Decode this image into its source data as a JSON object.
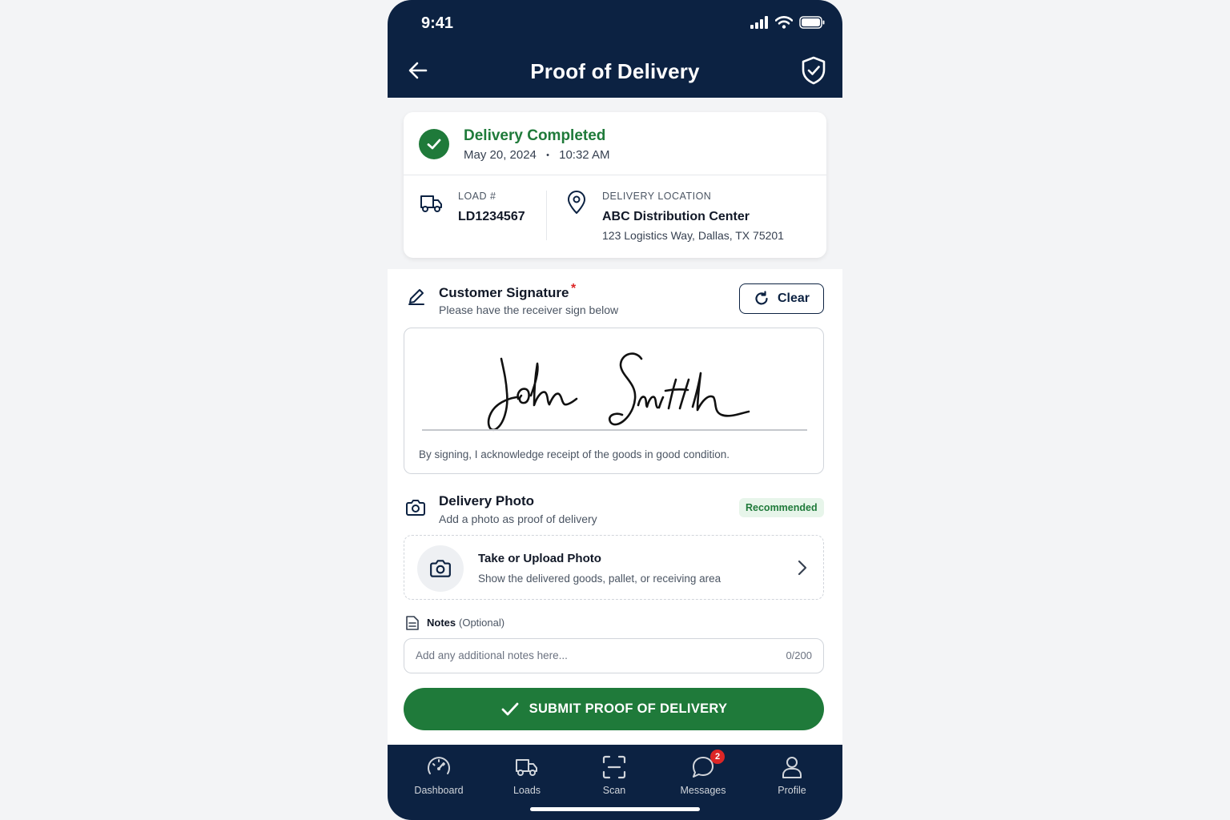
{
  "status_bar": {
    "time": "9:41"
  },
  "header": {
    "title": "Proof of Delivery"
  },
  "summary": {
    "status_title": "Delivery Completed",
    "date": "May 20, 2024",
    "separator": "•",
    "time": "10:32 AM",
    "load_label": "LOAD #",
    "load_value": "LD1234567",
    "location_label": "DELIVERY LOCATION",
    "location_name": "ABC Distribution Center",
    "location_address": "123 Logistics Way, Dallas, TX 75201"
  },
  "signature": {
    "title": "Customer Signature",
    "required_mark": "*",
    "subtitle": "Please have the receiver sign below",
    "clear_label": "Clear",
    "acknowledgement": "By signing, I acknowledge receipt of the goods in good condition."
  },
  "photo": {
    "title": "Delivery Photo",
    "subtitle": "Add a photo as proof of delivery",
    "badge": "Recommended",
    "upload_title": "Take or Upload Photo",
    "upload_subtitle": "Show the delivered goods, pallet, or receiving area"
  },
  "notes": {
    "label": "Notes",
    "optional": "(Optional)",
    "placeholder": "Add any additional notes here...",
    "value": "",
    "counter": "0/200"
  },
  "submit": {
    "label": "SUBMIT PROOF OF DELIVERY"
  },
  "nav": {
    "items": [
      {
        "label": "Dashboard",
        "icon": "speedometer-icon"
      },
      {
        "label": "Loads",
        "icon": "truck-icon"
      },
      {
        "label": "Scan",
        "icon": "scan-icon"
      },
      {
        "label": "Messages",
        "icon": "chat-icon",
        "badge": "2"
      },
      {
        "label": "Profile",
        "icon": "user-icon"
      }
    ]
  },
  "colors": {
    "primary_navy": "#0c2242",
    "success_green": "#1f7a3a",
    "danger_red": "#dc2626"
  }
}
